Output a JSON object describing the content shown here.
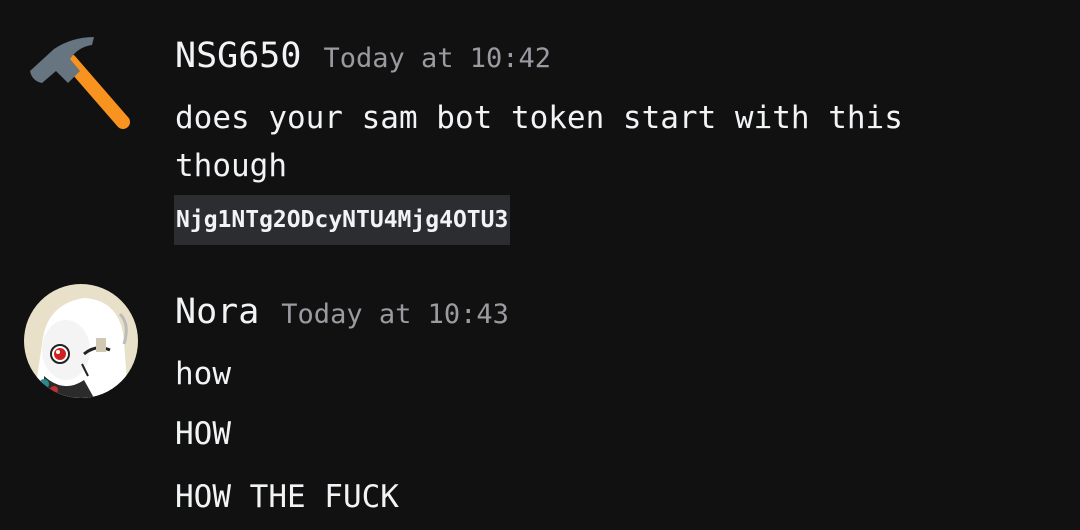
{
  "messages": [
    {
      "username": "NSG650",
      "timestamp": "Today at 10:42",
      "avatar_icon": "hammer-icon",
      "text_line_1": "does your sam bot token start with this",
      "text_line_2": "though",
      "code": "Njg1NTg2ODcyNTU4Mjg4OTU3"
    },
    {
      "username": "Nora",
      "timestamp": "Today at 10:43",
      "avatar_icon": "anime-character-avatar",
      "lines": [
        "how",
        "HOW",
        "HOW THE FUCK"
      ]
    }
  ],
  "colors": {
    "background": "#111112",
    "text": "#f2f3f5",
    "timestamp": "#9a9ba1",
    "code_background": "#2b2d31",
    "hammer_handle": "#f7931e",
    "hammer_head": "#66757f"
  }
}
